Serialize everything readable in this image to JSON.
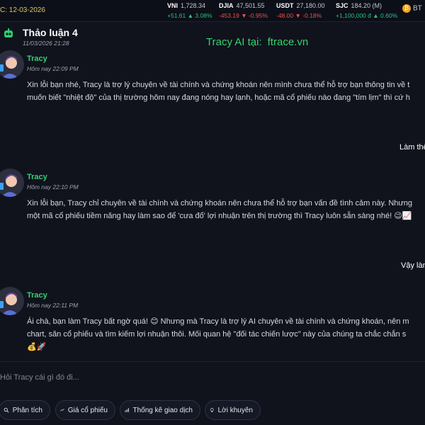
{
  "ticker": {
    "date": "C: 12-03-2026",
    "items": [
      {
        "name": "VNI",
        "value": "1,728.34",
        "change": "+51.61",
        "pct": "3.08%",
        "direction": "up"
      },
      {
        "name": "DJIA",
        "value": "47,501.55",
        "change": "-453.19",
        "pct": "-0.95%",
        "direction": "down"
      },
      {
        "name": "USDT",
        "value": "27,180.00",
        "change": "-48.00",
        "pct": "-0.18%",
        "direction": "down"
      },
      {
        "name": "SJC",
        "value": "184.20 (M)",
        "change": "+1,100,000 đ",
        "pct": "0.60%",
        "direction": "up"
      }
    ],
    "btc_label": "BT",
    "btc_coin": "₿"
  },
  "header": {
    "title": "Thảo luận 4",
    "date": "11/03/2026 21:28",
    "promo_text": "Tracy AI  tại:",
    "promo_url": "ftrace.vn"
  },
  "messages": [
    {
      "sender": "Tracy",
      "time": "Hôm nay 22:09 PM",
      "lines": [
        "Xin lỗi bạn nhé, Tracy là trợ lý chuyên về tài chính và chứng khoán nên mình chưa thể hỗ trợ bạn thông tin về t",
        "muốn biết \"nhiệt độ\" của thị trường hôm nay đang nóng hay lạnh, hoặc mã cổ phiếu nào đang \"tím lịm\" thì cứ h"
      ]
    },
    {
      "sender": "Tracy",
      "time": "Hôm nay 22:10 PM",
      "lines": [
        "Xin lỗi bạn, Tracy chỉ chuyên về tài chính và chứng khoán nên chưa thể hỗ trợ bạn vấn đề tình cảm này. Nhưng",
        "một mã cổ phiếu tiềm năng hay làm sao để 'cưa đổ' lợi nhuận trên thị trường thì Tracy luôn sẵn sàng nhé! 😉📈"
      ]
    },
    {
      "sender": "Tracy",
      "time": "Hôm nay 22:11 PM",
      "lines": [
        "Ái chà, bạn làm Tracy bất ngờ quá! 😊 Nhưng mà Tracy là trợ lý AI chuyên về tài chính và chứng khoán, nên m",
        "chart, săn cổ phiếu và tìm kiếm lợi nhuận thôi. Mối quan hệ \"đối tác chiến lược\" này của chúng ta chắc chắn s",
        "💰🚀"
      ]
    }
  ],
  "user_messages": [
    "Làm thế",
    "Vậy làm"
  ],
  "input": {
    "placeholder": "Hỏi Tracy cái gì đó đi..."
  },
  "chips": [
    {
      "label": "Phân tích",
      "icon": "analysis-icon"
    },
    {
      "label": "Giá cổ phiếu",
      "icon": "stock-price-icon"
    },
    {
      "label": "Thống kê giao dịch",
      "icon": "bar-chart-icon"
    },
    {
      "label": "Lời khuyên",
      "icon": "lightbulb-icon"
    }
  ]
}
